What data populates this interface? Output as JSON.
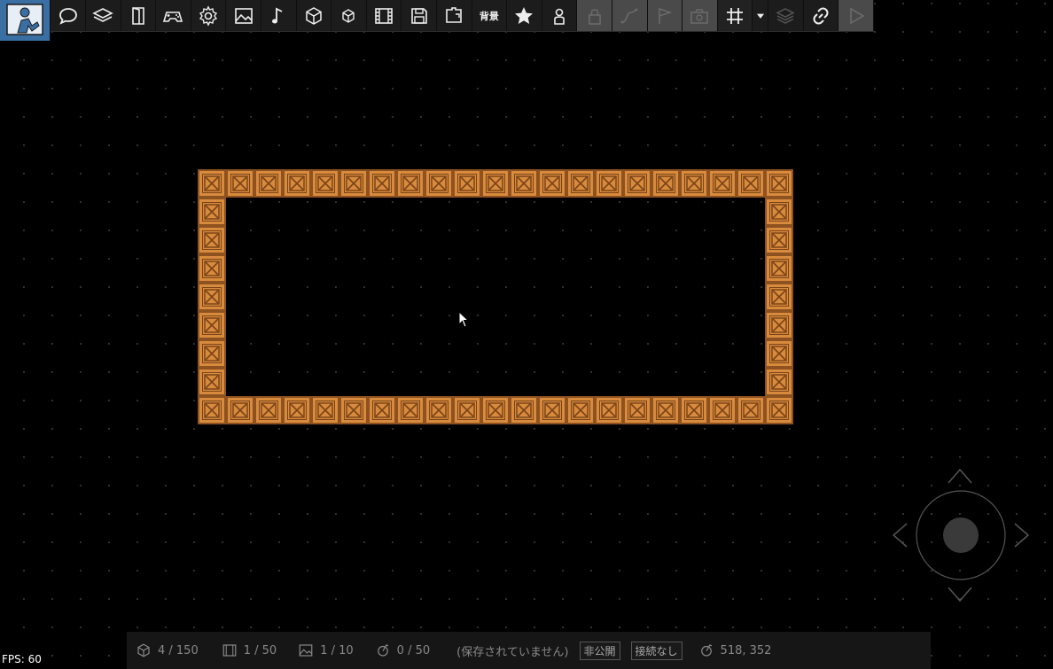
{
  "toolbar": {
    "buttons": [
      {
        "name": "logo-icon"
      },
      {
        "name": "chat-icon"
      },
      {
        "name": "layers-icon"
      },
      {
        "name": "door-icon"
      },
      {
        "name": "gamepad-icon"
      },
      {
        "name": "gear-icon"
      },
      {
        "name": "image-icon"
      },
      {
        "name": "music-icon"
      },
      {
        "name": "cube-icon"
      },
      {
        "name": "small-cube-icon"
      },
      {
        "name": "film-icon"
      },
      {
        "name": "save-icon"
      },
      {
        "name": "export-icon"
      },
      {
        "name": "background-text",
        "label": "背景"
      },
      {
        "name": "star-icon"
      },
      {
        "name": "person-icon"
      },
      {
        "name": "lock-icon",
        "disabled": true
      },
      {
        "name": "path-icon",
        "disabled": true
      },
      {
        "name": "flag-icon",
        "disabled": true
      },
      {
        "name": "camera-icon",
        "disabled": true
      },
      {
        "name": "grid-icon"
      },
      {
        "name": "dropdown-icon"
      },
      {
        "name": "layers-stack-icon"
      },
      {
        "name": "link-icon"
      },
      {
        "name": "play-icon",
        "disabled": true
      }
    ]
  },
  "status": {
    "objects": "4 / 150",
    "scenes": "1 / 50",
    "images": "1 / 10",
    "actions": "0 / 50",
    "save_state": "(保存されていません)",
    "visibility": "非公開",
    "connection": "接続なし",
    "coords": "518, 352"
  },
  "fps": "FPS: 60",
  "colors": {
    "crate_fill": "#d88a3d",
    "crate_border": "#8e5220",
    "logo_bg": "#3a6fa3"
  }
}
